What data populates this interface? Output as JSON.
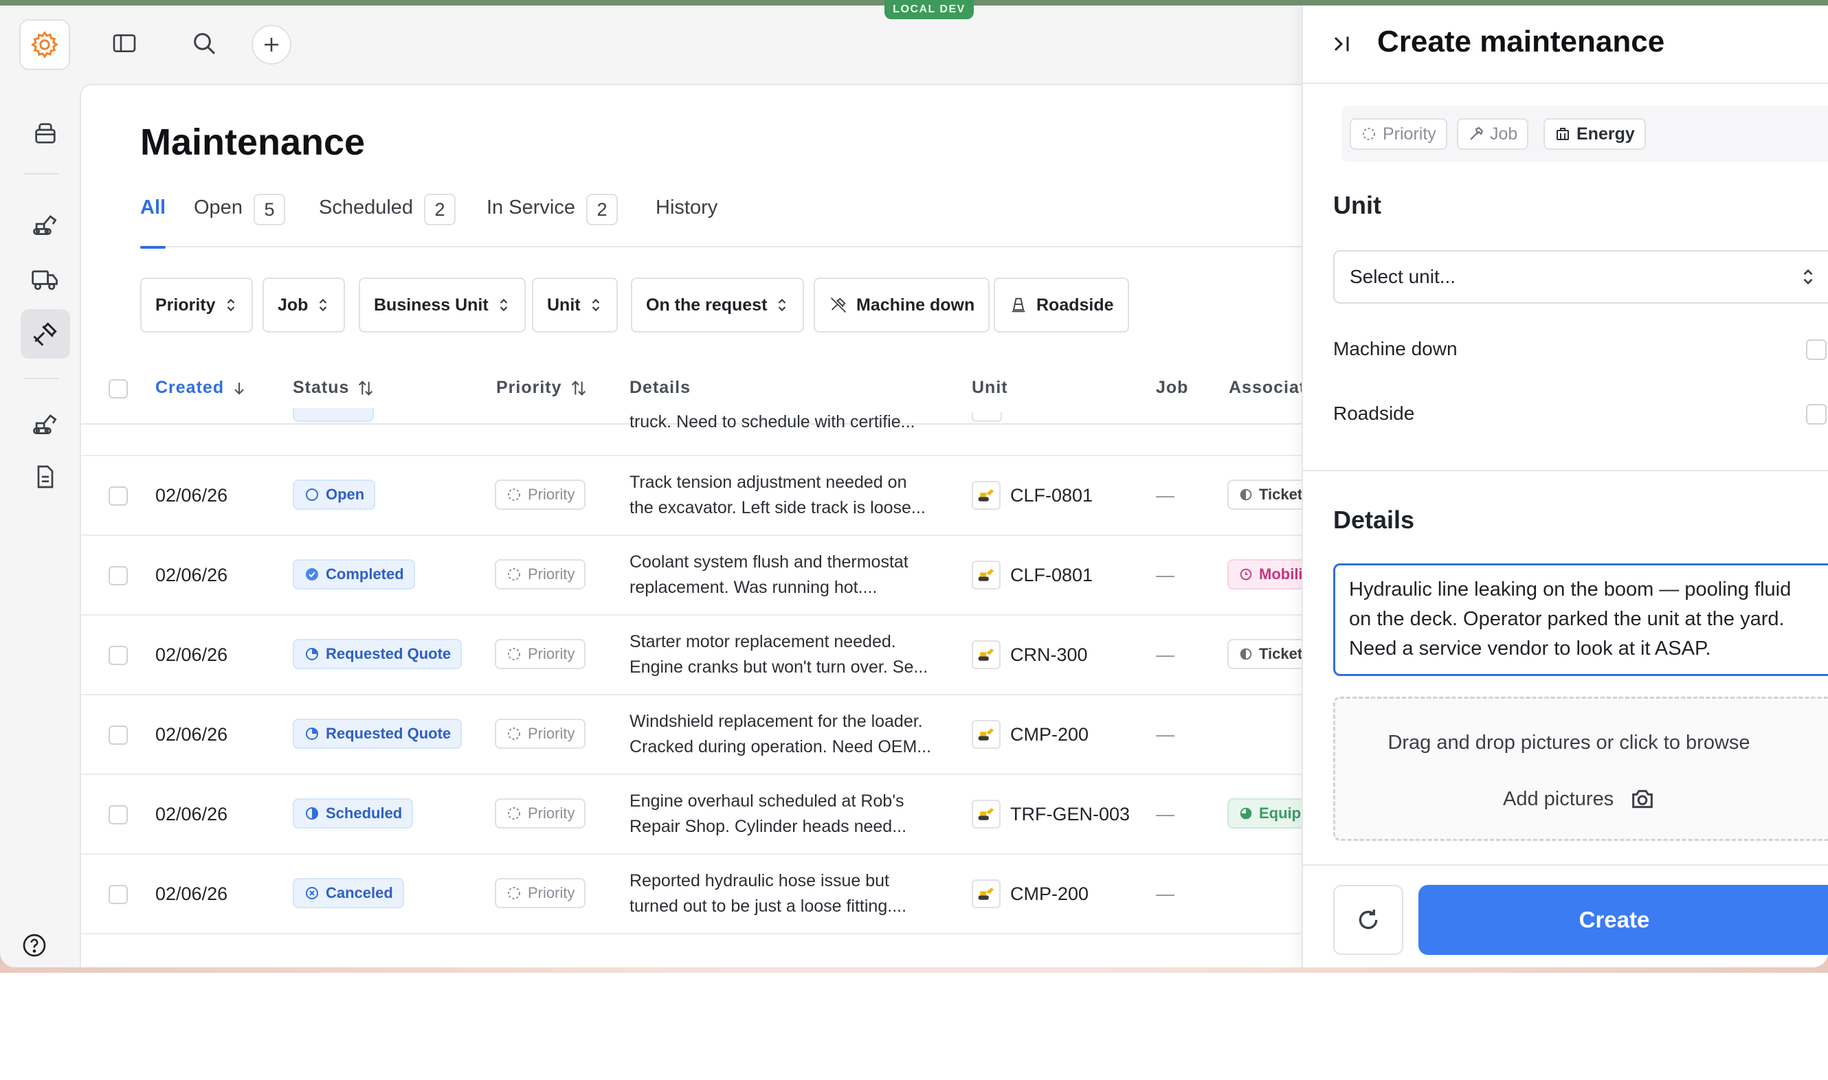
{
  "env_badge": "LOCAL DEV",
  "page_title": "Maintenance",
  "tabs": [
    {
      "label": "All"
    },
    {
      "label": "Open",
      "count": "5"
    },
    {
      "label": "Scheduled",
      "count": "2"
    },
    {
      "label": "In Service",
      "count": "2"
    },
    {
      "label": "History"
    }
  ],
  "filters": [
    "Priority",
    "Job",
    "Business Unit",
    "Unit",
    "On the request",
    "Machine down",
    "Roadside"
  ],
  "table": {
    "columns": [
      "Created",
      "Status",
      "Priority",
      "Details",
      "Unit",
      "Job",
      "Associat"
    ],
    "partial_top_text": "truck. Need to schedule with certifie...",
    "rows": [
      {
        "date": "02/06/26",
        "status": "Open",
        "priority": "Priority",
        "details": [
          "Track tension adjustment needed on",
          "the excavator. Left side track is loose..."
        ],
        "unit": "CLF-0801",
        "job": "—",
        "assoc": "Ticket"
      },
      {
        "date": "02/06/26",
        "status": "Completed",
        "priority": "Priority",
        "details": [
          "Coolant system flush and thermostat",
          "replacement. Was running hot...."
        ],
        "unit": "CLF-0801",
        "job": "—",
        "assoc": "Mobili"
      },
      {
        "date": "02/06/26",
        "status": "Requested Quote",
        "priority": "Priority",
        "details": [
          "Starter motor replacement needed.",
          "Engine cranks but won't turn over. Se..."
        ],
        "unit": "CRN-300",
        "job": "—",
        "assoc": "Ticket"
      },
      {
        "date": "02/06/26",
        "status": "Requested Quote",
        "priority": "Priority",
        "details": [
          "Windshield replacement for the loader.",
          "Cracked during operation. Need OEM..."
        ],
        "unit": "CMP-200",
        "job": "—",
        "assoc": ""
      },
      {
        "date": "02/06/26",
        "status": "Scheduled",
        "priority": "Priority",
        "details": [
          "Engine overhaul scheduled at Rob's",
          "Repair Shop. Cylinder heads need..."
        ],
        "unit": "TRF-GEN-003",
        "job": "—",
        "assoc": "Equip"
      },
      {
        "date": "02/06/26",
        "status": "Canceled",
        "priority": "Priority",
        "details": [
          "Reported hydraulic hose issue but",
          "turned out to be just a loose fitting...."
        ],
        "unit": "CMP-200",
        "job": "—",
        "assoc": ""
      }
    ]
  },
  "panel": {
    "title": "Create maintenance",
    "tags": [
      "Priority",
      "Job",
      "Energy"
    ],
    "unit_section": "Unit",
    "unit_placeholder": "Select unit...",
    "toggle_machine_down": "Machine down",
    "toggle_roadside": "Roadside",
    "details_section": "Details",
    "details_text": [
      "Hydraulic line leaking on the boom — pooling fluid",
      "on the deck. Operator parked the unit at the yard.",
      "Need a service vendor to look at it ASAP."
    ],
    "dropzone_text": "Drag and drop pictures or click to browse",
    "add_pictures": "Add pictures",
    "create_label": "Create"
  },
  "colors": {
    "accent": "#2f6fe0",
    "create_button": "#3b7cf2",
    "env_badge": "#3d9a5b"
  }
}
